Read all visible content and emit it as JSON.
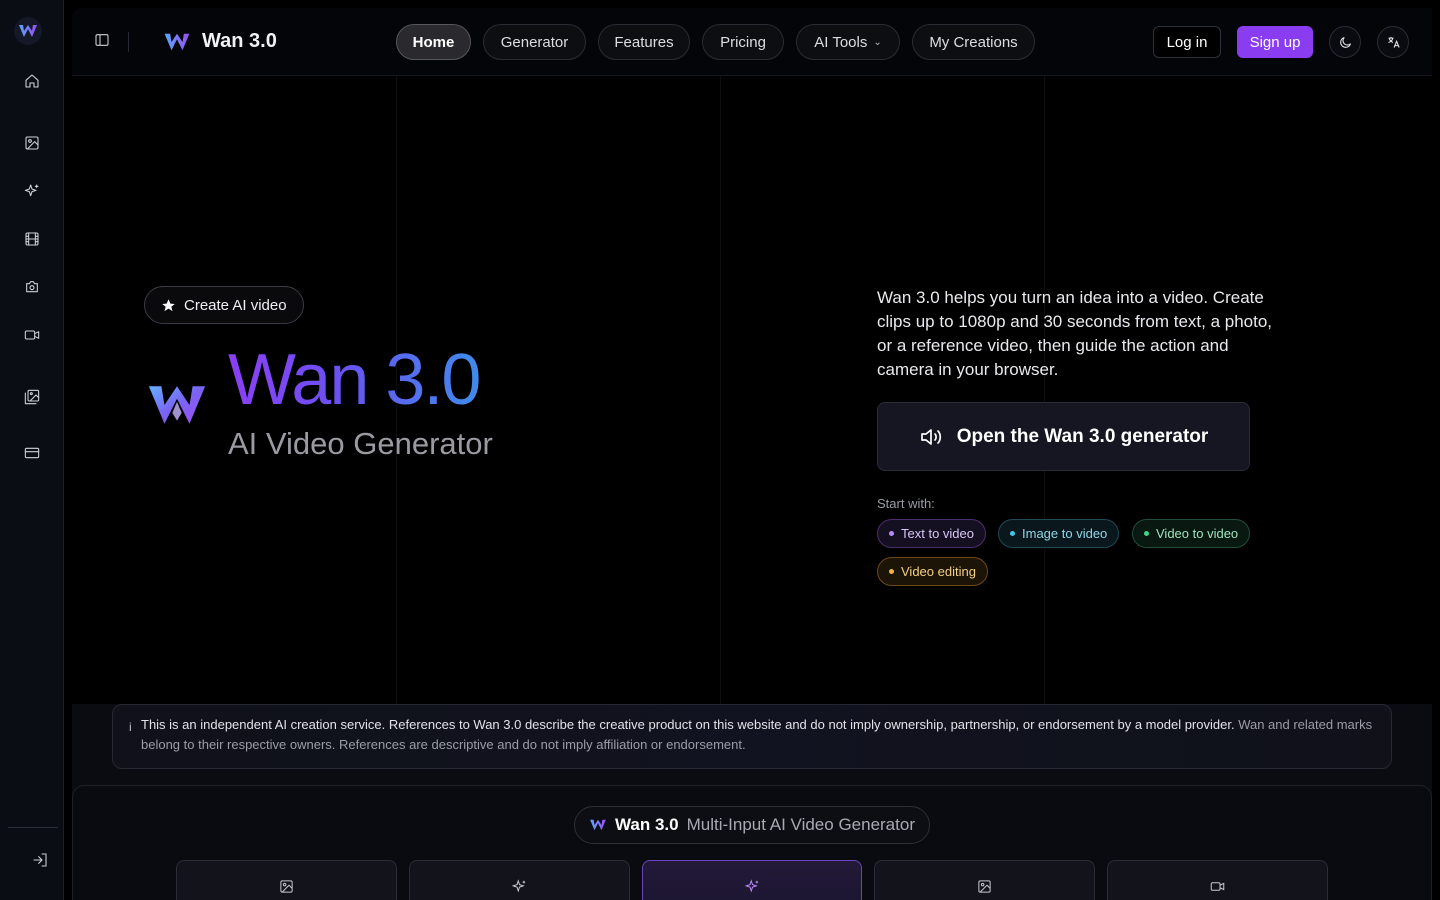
{
  "app": {
    "name": "Wan 3.0"
  },
  "rail": {
    "items": [
      "home-icon",
      "image-icon",
      "sparkles-icon",
      "film-icon",
      "camera-icon",
      "video-icon",
      "gallery-icon",
      "credit-card-icon"
    ],
    "footer": "sign-in-icon"
  },
  "header": {
    "brand": "Wan 3.0",
    "nav": [
      "Home",
      "Generator",
      "Features",
      "Pricing",
      "AI Tools",
      "My Creations"
    ],
    "active_nav": "Home",
    "login": "Log in",
    "signup": "Sign up"
  },
  "hero": {
    "chip": "Create AI video",
    "title": "Wan 3.0",
    "subtitle": "AI Video Generator",
    "description": "Wan 3.0 helps you turn an idea into a video. Create clips up to 1080p and 30 seconds from text, a photo, or a reference video, then guide the action and camera in your browser.",
    "cta": "Open the Wan 3.0 generator",
    "start_label": "Start with:",
    "tags": [
      "Text to video",
      "Image to video",
      "Video to video",
      "Video editing"
    ]
  },
  "notice": {
    "icon": "i",
    "main": "This is an independent AI creation service. References to Wan 3.0 describe the creative product on this website and do not imply ownership, partnership, or endorsement by a model provider.",
    "muted": "Wan and related marks belong to their respective owners. References are descriptive and do not imply affiliation or endorsement."
  },
  "generator": {
    "badge_name": "Wan 3.0",
    "badge_desc": "Multi-Input AI Video Generator",
    "tabs": [
      "image-icon",
      "sparkles-icon",
      "sparkles-icon",
      "image-icon",
      "video-icon"
    ],
    "active_tab": 2
  },
  "colors": {
    "accent": "#8a3cf0",
    "title_gradient": [
      "#8b3ff5",
      "#3f8bea"
    ]
  }
}
